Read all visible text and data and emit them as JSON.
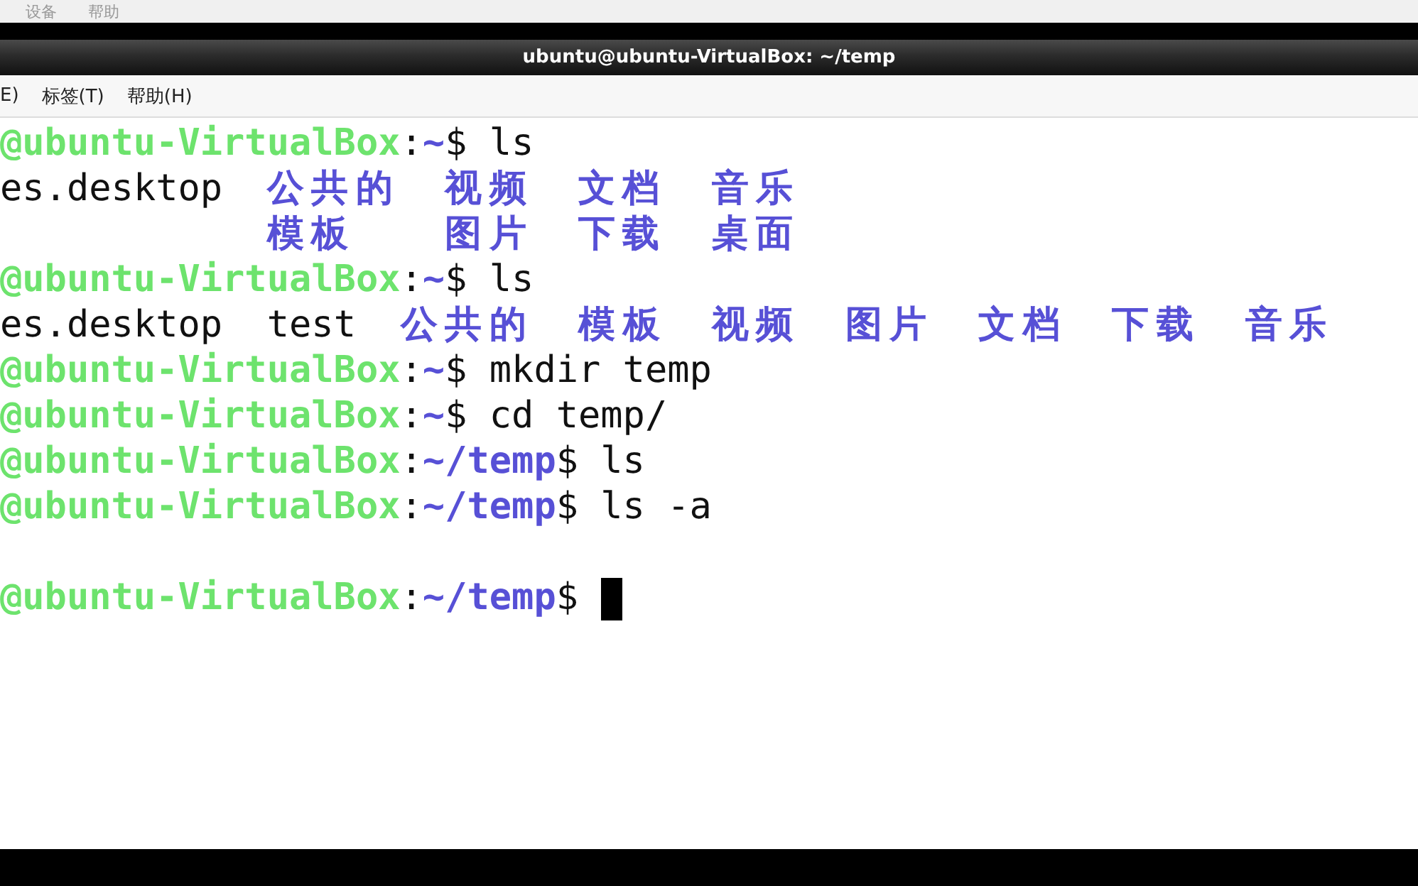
{
  "host_menu": [
    "设备",
    "帮助"
  ],
  "window": {
    "title": "ubuntu@ubuntu-VirtualBox: ~/temp"
  },
  "menu": [
    "E)",
    "标签(T)",
    "帮助(H)"
  ],
  "terminal": {
    "lines": [
      {
        "kind": "prompt",
        "host": "@ubuntu-VirtualBox",
        "separator": ":",
        "path": "~",
        "sign": "$",
        "command": "ls"
      },
      {
        "kind": "listing",
        "columns": [
          [
            {
              "name": "es.desktop",
              "kind": "file"
            }
          ],
          [
            {
              "name": "公共的",
              "kind": "dir"
            },
            {
              "name": "模板",
              "kind": "dir"
            }
          ],
          [
            {
              "name": "视频",
              "kind": "dir"
            },
            {
              "name": "图片",
              "kind": "dir"
            }
          ],
          [
            {
              "name": "文档",
              "kind": "dir"
            },
            {
              "name": "下载",
              "kind": "dir"
            }
          ],
          [
            {
              "name": "音乐",
              "kind": "dir"
            },
            {
              "name": "桌面",
              "kind": "dir"
            }
          ]
        ]
      },
      {
        "kind": "prompt",
        "host": "@ubuntu-VirtualBox",
        "separator": ":",
        "path": "~",
        "sign": "$",
        "command": "ls"
      },
      {
        "kind": "listing",
        "columns": [
          [
            {
              "name": "es.desktop",
              "kind": "file"
            }
          ],
          [
            {
              "name": "test",
              "kind": "file"
            }
          ],
          [
            {
              "name": "公共的",
              "kind": "dir"
            }
          ],
          [
            {
              "name": "模板",
              "kind": "dir"
            }
          ],
          [
            {
              "name": "视频",
              "kind": "dir"
            }
          ],
          [
            {
              "name": "图片",
              "kind": "dir"
            }
          ],
          [
            {
              "name": "文档",
              "kind": "dir"
            }
          ],
          [
            {
              "name": "下载",
              "kind": "dir"
            }
          ],
          [
            {
              "name": "音乐",
              "kind": "dir"
            }
          ]
        ]
      },
      {
        "kind": "prompt",
        "host": "@ubuntu-VirtualBox",
        "separator": ":",
        "path": "~",
        "sign": "$",
        "command": "mkdir temp"
      },
      {
        "kind": "prompt",
        "host": "@ubuntu-VirtualBox",
        "separator": ":",
        "path": "~",
        "sign": "$",
        "command": "cd temp/"
      },
      {
        "kind": "prompt",
        "host": "@ubuntu-VirtualBox",
        "separator": ":",
        "path": "~/temp",
        "sign": "$",
        "command": "ls"
      },
      {
        "kind": "prompt",
        "host": "@ubuntu-VirtualBox",
        "separator": ":",
        "path": "~/temp",
        "sign": "$",
        "command": "ls -a"
      },
      {
        "kind": "blank"
      },
      {
        "kind": "prompt",
        "host": "@ubuntu-VirtualBox",
        "separator": ":",
        "path": "~/temp",
        "sign": "$",
        "cursor": true
      }
    ]
  }
}
